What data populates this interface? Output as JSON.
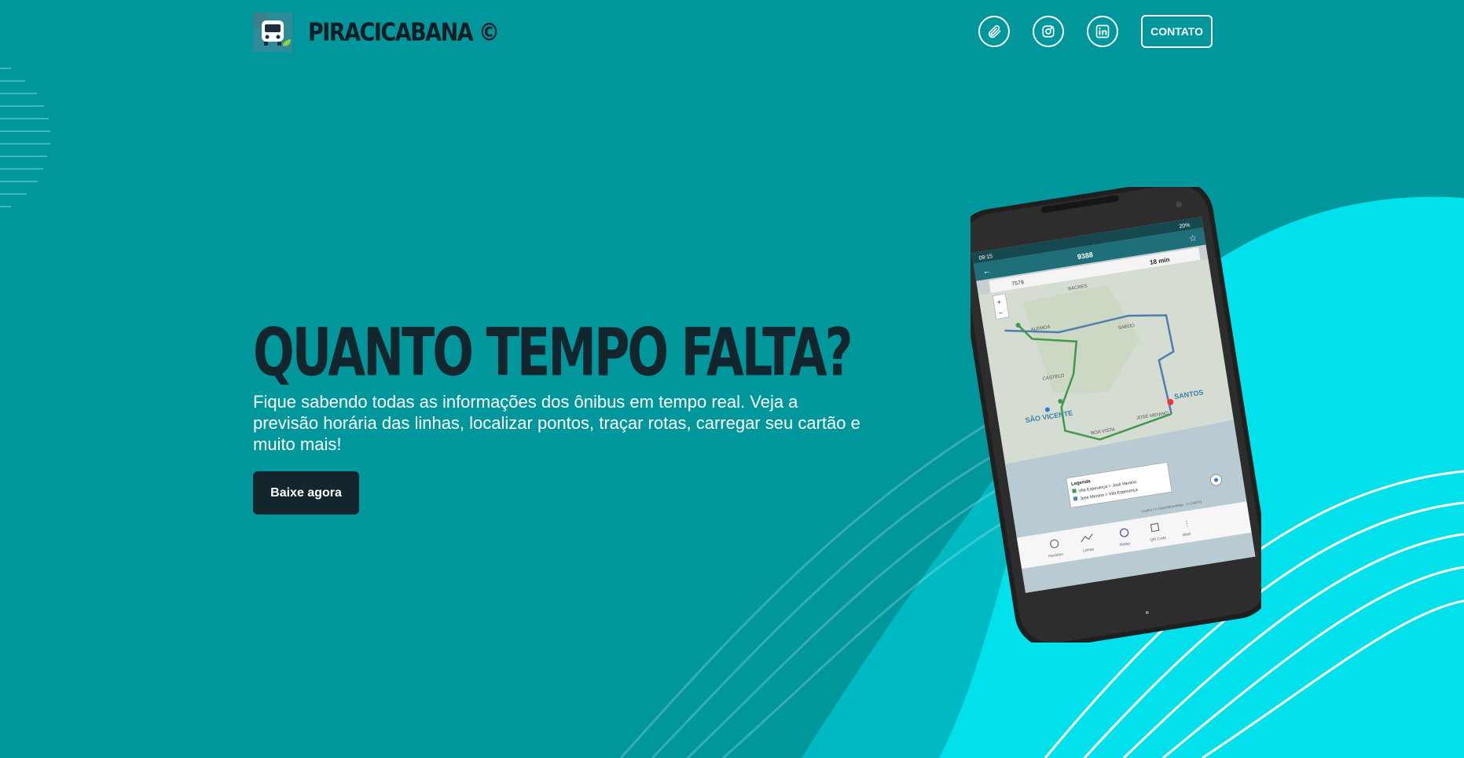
{
  "header": {
    "brand_name": "PIRACICABANA ©",
    "social_icons": [
      "paperclip-icon",
      "instagram-icon",
      "linkedin-icon"
    ],
    "contact_label": "CONTATO"
  },
  "hero": {
    "title": "QUANTO TEMPO FALTA?",
    "description": "Fique sabendo todas as informações dos ônibus em tempo real. Veja a previsão horária das linhas, localizar pontos, traçar rotas, carregar seu cartão e muito mais!",
    "cta_label": "Baixe agora"
  },
  "phone_screen": {
    "time": "09:15",
    "battery": "20%",
    "line": "9388",
    "vehicle": "7579",
    "eta": "18 min",
    "zoom_in": "+",
    "zoom_out": "−",
    "places": [
      "BACRES",
      "ALEMOA",
      "SABOO",
      "CASTELO",
      "SÃO VICENTE",
      "SANTOS",
      "BOA VISTA",
      "JOSÉ MENINO"
    ],
    "legend_title": "Legenda",
    "legend_items": [
      "Vila Esperança > José Menino",
      "José Menino > Vila Esperança"
    ],
    "attribution": "Leaflet | © OpenStreetMap · © CARTO",
    "nav_items": [
      "Horários",
      "Linhas",
      "Rotas",
      "QR Code",
      "Mais"
    ]
  },
  "colors": {
    "background": "#00979c",
    "wave": "#00e1ec",
    "dark": "#13262d",
    "white": "#ffffff"
  }
}
